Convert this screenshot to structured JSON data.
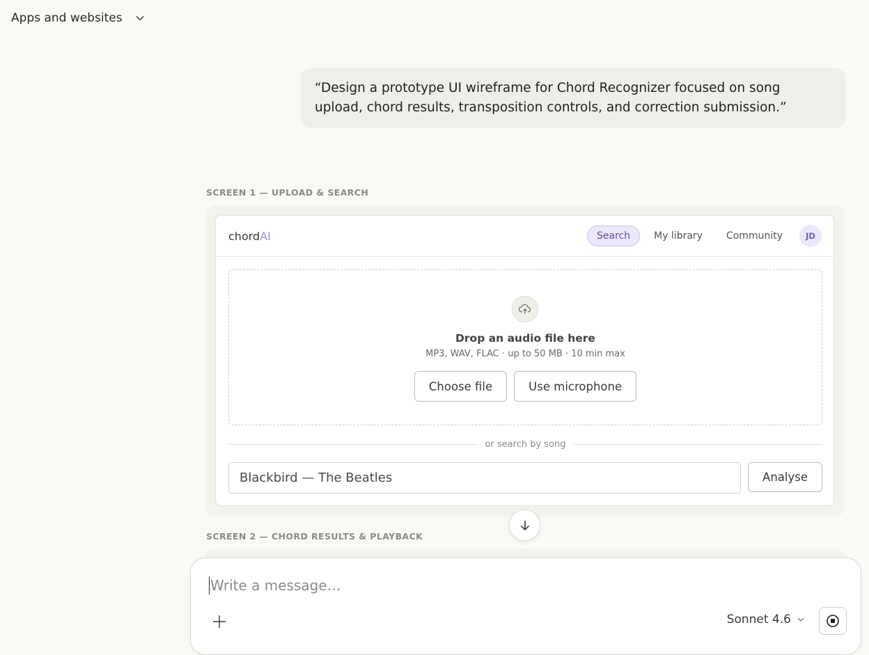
{
  "topbar": {
    "title": "Apps and websites"
  },
  "user_message": {
    "text": "“Design a prototype UI wireframe for Chord Recognizer focused on song upload, chord results, transposition controls, and correction submission.”"
  },
  "screen1": {
    "label": "SCREEN 1 — UPLOAD & SEARCH",
    "logo_main": "chord",
    "logo_accent": "AI",
    "nav": [
      "Search",
      "My library",
      "Community"
    ],
    "avatar": "JD",
    "drop_title": "Drop an audio file here",
    "drop_sub": "MP3, WAV, FLAC · up to 50 MB · 10 min max",
    "choose_file": "Choose file",
    "use_mic": "Use microphone",
    "divider": "or search by song",
    "search_value": "Blackbird — The Beatles",
    "analyse": "Analyse"
  },
  "screen2": {
    "label": "SCREEN 2 — CHORD RESULTS & PLAYBACK"
  },
  "composer": {
    "placeholder": "Write a message…",
    "model": "Sonnet 4.6"
  }
}
